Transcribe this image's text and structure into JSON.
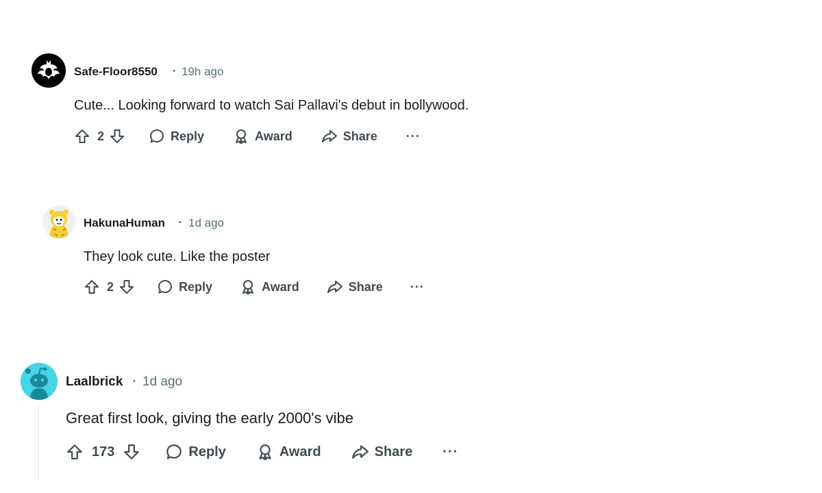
{
  "labels": {
    "reply": "Reply",
    "award": "Award",
    "share": "Share",
    "more": "···",
    "sep": "•"
  },
  "comments": [
    {
      "author": "Safe-Floor8550",
      "time": "19h ago",
      "text": "Cute... Looking forward to watch Sai Pallavi's debut in bollywood.",
      "votes": "2",
      "avatar_icon": "batman-avatar-icon"
    },
    {
      "author": "HakunaHuman",
      "time": "1d ago",
      "text": "They look cute. Like the poster",
      "votes": "2",
      "avatar_icon": "tiger-costume-avatar-icon"
    },
    {
      "author": "Laalbrick",
      "time": "1d ago",
      "text": "Great first look, giving the early 2000's vibe",
      "votes": "173",
      "avatar_icon": "snoo-avatar-icon"
    }
  ],
  "colors": {
    "meta": "#576f76",
    "text": "#1c1c1c",
    "action": "#3f4a4f",
    "snoo_bg": "#46d4e6",
    "snoo": "#1a8a99"
  }
}
